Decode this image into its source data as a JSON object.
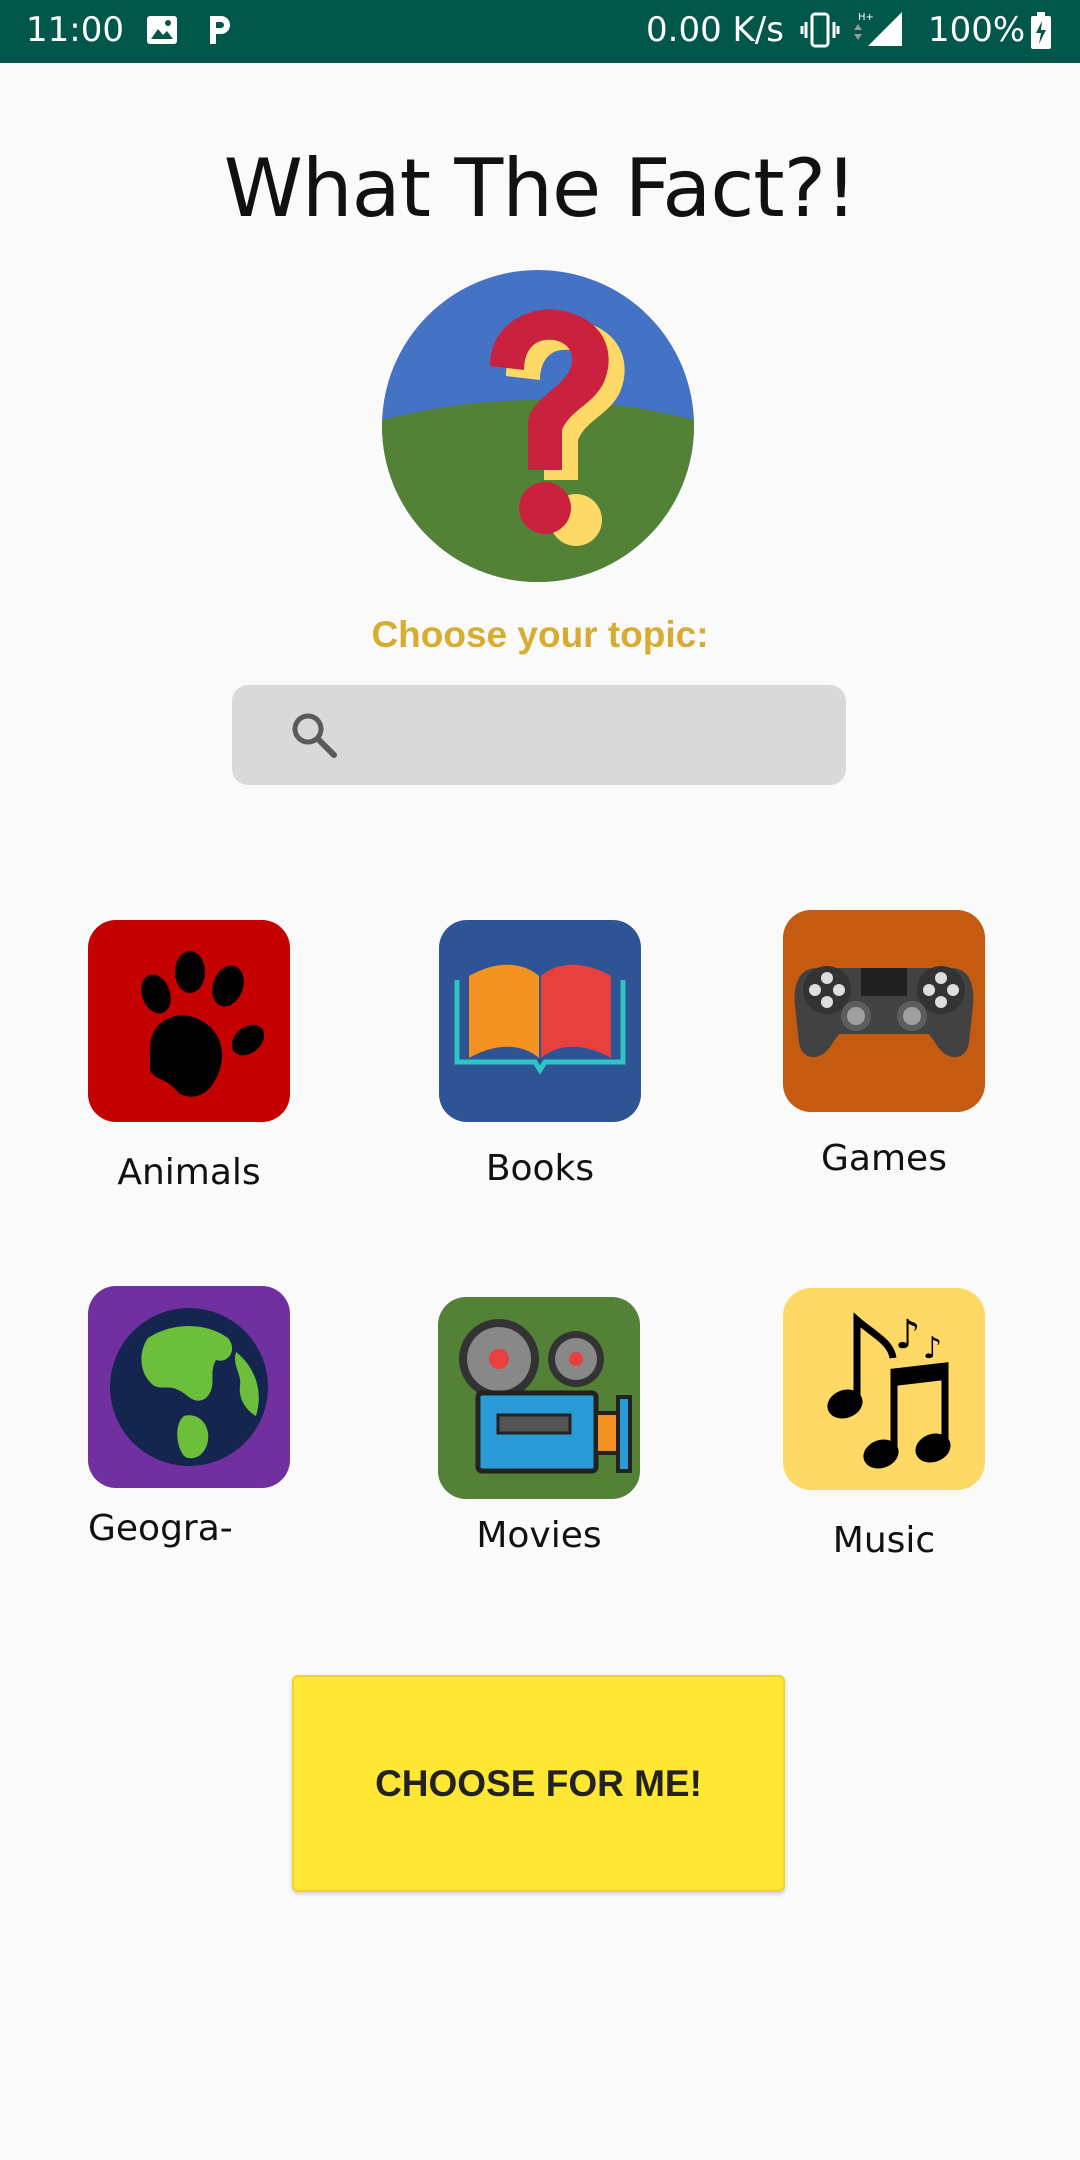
{
  "status_bar": {
    "time": "11:00",
    "net_speed": "0.00 K/s",
    "battery": "100%"
  },
  "app": {
    "title": "What The Fact?!",
    "choose_label": "Choose your topic:",
    "search_placeholder": ""
  },
  "topics": [
    {
      "label": "Animals",
      "icon": "paw-icon",
      "color": "#c40000"
    },
    {
      "label": "Books",
      "icon": "book-icon",
      "color": "#2f5496"
    },
    {
      "label": "Games",
      "icon": "gamepad-icon",
      "color": "#c55a11"
    },
    {
      "label": "Geogra-",
      "icon": "globe-icon",
      "color": "#7030a0"
    },
    {
      "label": "Movies",
      "icon": "projector-icon",
      "color": "#538135"
    },
    {
      "label": "Music",
      "icon": "music-notes-icon",
      "color": "#ffd966"
    }
  ],
  "button": {
    "choose_for_me": "CHOOSE FOR ME!"
  },
  "colors": {
    "status_bar": "#01574a",
    "accent_label": "#d7ac32",
    "button": "#ffe733"
  }
}
